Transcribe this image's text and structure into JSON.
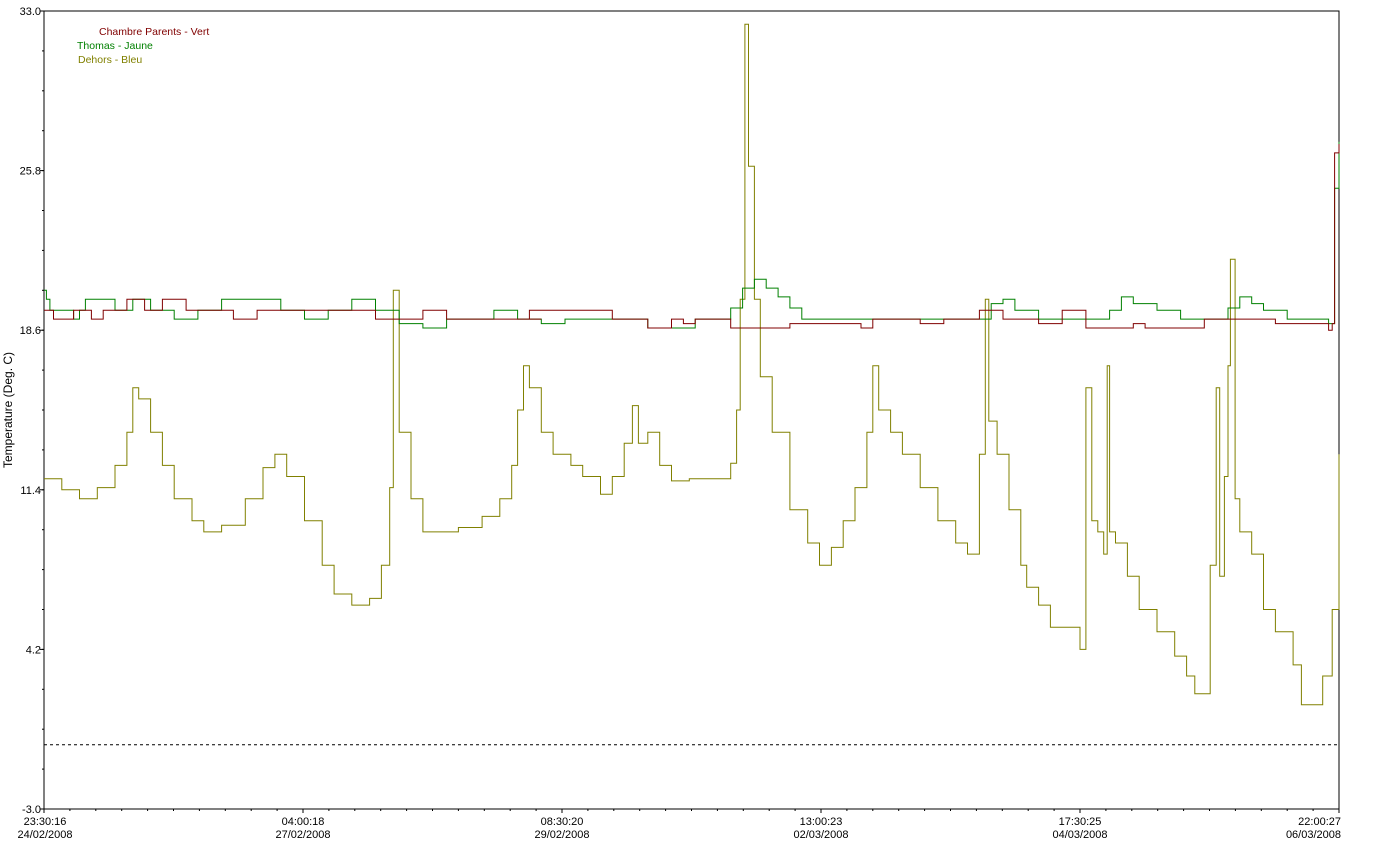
{
  "chart_data": {
    "type": "line",
    "ylabel": "Temperature (Deg. C)",
    "ylim": [
      -3.0,
      33.0
    ],
    "y_ticks": [
      "33.0",
      "25.8",
      "18.6",
      "11.4",
      "4.2",
      "-3.0"
    ],
    "y_tick_values": [
      33.0,
      25.8,
      18.6,
      11.4,
      4.2,
      -3.0
    ],
    "x_ticks": [
      {
        "time": "23:30:16",
        "date": "24/02/2008"
      },
      {
        "time": "04:00:18",
        "date": "27/02/2008"
      },
      {
        "time": "08:30:20",
        "date": "29/02/2008"
      },
      {
        "time": "13:00:23",
        "date": "02/03/2008"
      },
      {
        "time": "17:30:25",
        "date": "04/03/2008"
      },
      {
        "time": "22:00:27",
        "date": "06/03/2008"
      }
    ],
    "x_tick_days": [
      0,
      2.1875,
      4.375,
      6.5625,
      8.75,
      10.9375
    ],
    "xlim_days": [
      0,
      10.9375
    ],
    "reference_line": {
      "value": -0.1,
      "style": "dashed",
      "color": "#000000"
    },
    "grid": false,
    "legend_position": "top-left",
    "colors": {
      "chambre": "#800000",
      "thomas": "#008000",
      "dehors": "#808000"
    },
    "legend": [
      {
        "label": "Chambre Parents - Vert",
        "color": "#800000"
      },
      {
        "label": "Thomas - Jaune",
        "color": "#008000"
      },
      {
        "label": "Dehors - Bleu",
        "color": "#808000"
      }
    ],
    "series": [
      {
        "name": "Chambre Parents - Vert",
        "color": "#800000",
        "points": [
          [
            0,
            19.5
          ],
          [
            0.05,
            19.5
          ],
          [
            0.08,
            19.1
          ],
          [
            0.15,
            19.1
          ],
          [
            0.25,
            19.5
          ],
          [
            0.4,
            19.1
          ],
          [
            0.5,
            19.5
          ],
          [
            0.7,
            20.0
          ],
          [
            0.85,
            19.5
          ],
          [
            1.0,
            20.0
          ],
          [
            1.2,
            19.5
          ],
          [
            1.5,
            19.5
          ],
          [
            1.6,
            19.1
          ],
          [
            1.8,
            19.5
          ],
          [
            2.0,
            19.5
          ],
          [
            2.2,
            19.5
          ],
          [
            2.5,
            19.5
          ],
          [
            2.8,
            19.1
          ],
          [
            3.0,
            19.1
          ],
          [
            3.2,
            19.5
          ],
          [
            3.4,
            19.1
          ],
          [
            3.6,
            19.1
          ],
          [
            3.8,
            19.1
          ],
          [
            4.0,
            19.1
          ],
          [
            4.2,
            19.1
          ],
          [
            4.1,
            19.5
          ],
          [
            4.4,
            19.5
          ],
          [
            4.6,
            19.5
          ],
          [
            4.8,
            19.1
          ],
          [
            5.0,
            19.1
          ],
          [
            5.1,
            18.7
          ],
          [
            5.2,
            18.7
          ],
          [
            5.3,
            19.1
          ],
          [
            5.4,
            18.9
          ],
          [
            5.5,
            19.1
          ],
          [
            5.6,
            19.1
          ],
          [
            5.8,
            18.7
          ],
          [
            5.9,
            18.7
          ],
          [
            6.1,
            18.7
          ],
          [
            6.3,
            18.9
          ],
          [
            6.5,
            18.9
          ],
          [
            6.7,
            18.9
          ],
          [
            6.9,
            18.7
          ],
          [
            7.0,
            19.1
          ],
          [
            7.2,
            19.1
          ],
          [
            7.4,
            18.9
          ],
          [
            7.6,
            19.1
          ],
          [
            7.8,
            19.1
          ],
          [
            7.9,
            19.5
          ],
          [
            8.1,
            19.1
          ],
          [
            8.3,
            19.1
          ],
          [
            8.4,
            18.9
          ],
          [
            8.6,
            19.5
          ],
          [
            8.8,
            18.7
          ],
          [
            9.0,
            18.7
          ],
          [
            9.2,
            18.9
          ],
          [
            9.3,
            18.7
          ],
          [
            9.5,
            18.7
          ],
          [
            9.7,
            18.7
          ],
          [
            9.8,
            19.1
          ],
          [
            10.0,
            19.1
          ],
          [
            10.2,
            19.1
          ],
          [
            10.4,
            18.9
          ],
          [
            10.6,
            18.9
          ],
          [
            10.8,
            18.9
          ],
          [
            10.85,
            18.6
          ],
          [
            10.88,
            18.9
          ],
          [
            10.9,
            26.6
          ],
          [
            10.9375,
            27.0
          ]
        ]
      },
      {
        "name": "Thomas - Jaune",
        "color": "#008000",
        "points": [
          [
            0,
            20.4
          ],
          [
            0.02,
            20.0
          ],
          [
            0.05,
            19.5
          ],
          [
            0.15,
            19.5
          ],
          [
            0.25,
            19.1
          ],
          [
            0.3,
            19.5
          ],
          [
            0.35,
            20.0
          ],
          [
            0.45,
            20.0
          ],
          [
            0.6,
            19.5
          ],
          [
            0.75,
            20.0
          ],
          [
            0.9,
            19.5
          ],
          [
            1.1,
            19.1
          ],
          [
            1.3,
            19.5
          ],
          [
            1.5,
            20.0
          ],
          [
            1.8,
            20.0
          ],
          [
            2.0,
            19.5
          ],
          [
            2.2,
            19.1
          ],
          [
            2.4,
            19.5
          ],
          [
            2.6,
            20.0
          ],
          [
            2.8,
            19.5
          ],
          [
            3.0,
            18.9
          ],
          [
            3.2,
            18.7
          ],
          [
            3.4,
            19.1
          ],
          [
            3.6,
            19.1
          ],
          [
            3.8,
            19.5
          ],
          [
            4.0,
            19.1
          ],
          [
            4.2,
            18.9
          ],
          [
            4.4,
            19.1
          ],
          [
            4.6,
            19.1
          ],
          [
            4.8,
            19.1
          ],
          [
            5.0,
            19.1
          ],
          [
            5.1,
            18.7
          ],
          [
            5.3,
            18.7
          ],
          [
            5.5,
            19.1
          ],
          [
            5.7,
            19.1
          ],
          [
            5.8,
            19.6
          ],
          [
            5.9,
            20.5
          ],
          [
            6.0,
            20.9
          ],
          [
            6.1,
            20.5
          ],
          [
            6.2,
            20.1
          ],
          [
            6.3,
            19.6
          ],
          [
            6.4,
            19.1
          ],
          [
            6.6,
            19.1
          ],
          [
            6.8,
            19.1
          ],
          [
            7.0,
            19.1
          ],
          [
            7.2,
            19.1
          ],
          [
            7.4,
            19.1
          ],
          [
            7.6,
            19.1
          ],
          [
            7.8,
            19.1
          ],
          [
            8.0,
            19.8
          ],
          [
            8.1,
            20.0
          ],
          [
            8.2,
            19.5
          ],
          [
            8.4,
            19.1
          ],
          [
            8.6,
            19.1
          ],
          [
            8.8,
            19.1
          ],
          [
            9.0,
            19.5
          ],
          [
            9.1,
            20.1
          ],
          [
            9.2,
            19.8
          ],
          [
            9.4,
            19.5
          ],
          [
            9.6,
            19.1
          ],
          [
            9.8,
            19.1
          ],
          [
            10.0,
            19.6
          ],
          [
            10.1,
            20.1
          ],
          [
            10.2,
            19.8
          ],
          [
            10.3,
            19.5
          ],
          [
            10.5,
            19.1
          ],
          [
            10.7,
            19.1
          ],
          [
            10.85,
            18.9
          ],
          [
            10.88,
            18.9
          ],
          [
            10.9,
            25.0
          ],
          [
            10.9375,
            27.1
          ]
        ]
      },
      {
        "name": "Dehors - Bleu",
        "color": "#808000",
        "points": [
          [
            0,
            11.9
          ],
          [
            0.15,
            11.4
          ],
          [
            0.3,
            11.0
          ],
          [
            0.45,
            11.5
          ],
          [
            0.6,
            12.5
          ],
          [
            0.7,
            14.0
          ],
          [
            0.75,
            16.0
          ],
          [
            0.8,
            15.5
          ],
          [
            0.9,
            14.0
          ],
          [
            1.0,
            12.5
          ],
          [
            1.1,
            11.0
          ],
          [
            1.25,
            10.0
          ],
          [
            1.35,
            9.5
          ],
          [
            1.5,
            9.8
          ],
          [
            1.7,
            11.0
          ],
          [
            1.85,
            12.4
          ],
          [
            1.95,
            13.0
          ],
          [
            2.05,
            12.0
          ],
          [
            2.2,
            10.0
          ],
          [
            2.35,
            8.0
          ],
          [
            2.45,
            6.7
          ],
          [
            2.6,
            6.2
          ],
          [
            2.75,
            6.5
          ],
          [
            2.85,
            8.0
          ],
          [
            2.92,
            11.5
          ],
          [
            2.95,
            20.4
          ],
          [
            3.0,
            14.0
          ],
          [
            3.1,
            11.0
          ],
          [
            3.2,
            9.5
          ],
          [
            3.35,
            9.5
          ],
          [
            3.5,
            9.7
          ],
          [
            3.7,
            10.2
          ],
          [
            3.85,
            11.0
          ],
          [
            3.95,
            12.5
          ],
          [
            4.0,
            15.0
          ],
          [
            4.05,
            17.0
          ],
          [
            4.1,
            16.0
          ],
          [
            4.2,
            14.0
          ],
          [
            4.3,
            13.0
          ],
          [
            4.45,
            12.5
          ],
          [
            4.55,
            12.0
          ],
          [
            4.7,
            11.2
          ],
          [
            4.8,
            12.0
          ],
          [
            4.9,
            13.5
          ],
          [
            4.97,
            15.2
          ],
          [
            5.02,
            13.5
          ],
          [
            5.1,
            14.0
          ],
          [
            5.2,
            12.5
          ],
          [
            5.3,
            11.8
          ],
          [
            5.45,
            11.9
          ],
          [
            5.6,
            11.9
          ],
          [
            5.7,
            11.9
          ],
          [
            5.8,
            12.6
          ],
          [
            5.85,
            15.0
          ],
          [
            5.88,
            20.0
          ],
          [
            5.92,
            32.4
          ],
          [
            5.95,
            26.0
          ],
          [
            6.0,
            20.0
          ],
          [
            6.05,
            16.5
          ],
          [
            6.15,
            14.0
          ],
          [
            6.3,
            10.5
          ],
          [
            6.45,
            9.0
          ],
          [
            6.55,
            8.0
          ],
          [
            6.65,
            8.8
          ],
          [
            6.75,
            10.0
          ],
          [
            6.85,
            11.5
          ],
          [
            6.95,
            14.0
          ],
          [
            7.0,
            17.0
          ],
          [
            7.05,
            15.0
          ],
          [
            7.15,
            14.0
          ],
          [
            7.25,
            13.0
          ],
          [
            7.4,
            11.5
          ],
          [
            7.55,
            10.0
          ],
          [
            7.7,
            9.0
          ],
          [
            7.8,
            8.5
          ],
          [
            7.9,
            13.0
          ],
          [
            7.95,
            20.0
          ],
          [
            7.98,
            14.5
          ],
          [
            8.05,
            13.0
          ],
          [
            8.15,
            10.5
          ],
          [
            8.25,
            8.0
          ],
          [
            8.3,
            7.0
          ],
          [
            8.4,
            6.2
          ],
          [
            8.5,
            5.2
          ],
          [
            8.65,
            5.2
          ],
          [
            8.75,
            4.2
          ],
          [
            8.8,
            16.0
          ],
          [
            8.85,
            10.0
          ],
          [
            8.9,
            9.5
          ],
          [
            8.95,
            8.5
          ],
          [
            8.98,
            17.0
          ],
          [
            9.0,
            9.5
          ],
          [
            9.05,
            9.0
          ],
          [
            9.15,
            7.5
          ],
          [
            9.25,
            6.0
          ],
          [
            9.4,
            5.0
          ],
          [
            9.55,
            3.9
          ],
          [
            9.65,
            3.0
          ],
          [
            9.72,
            2.2
          ],
          [
            9.8,
            2.2
          ],
          [
            9.85,
            8.0
          ],
          [
            9.9,
            16.0
          ],
          [
            9.93,
            7.5
          ],
          [
            9.97,
            12.0
          ],
          [
            10.0,
            17.0
          ],
          [
            10.02,
            21.8
          ],
          [
            10.06,
            11.0
          ],
          [
            10.1,
            9.5
          ],
          [
            10.2,
            8.5
          ],
          [
            10.3,
            6.0
          ],
          [
            10.4,
            5.0
          ],
          [
            10.55,
            3.5
          ],
          [
            10.62,
            1.7
          ],
          [
            10.7,
            1.7
          ],
          [
            10.8,
            3.0
          ],
          [
            10.88,
            6.0
          ],
          [
            10.95,
            9.5
          ],
          [
            11.0,
            13.0
          ],
          [
            10.9375,
            9.0
          ]
        ]
      }
    ]
  }
}
